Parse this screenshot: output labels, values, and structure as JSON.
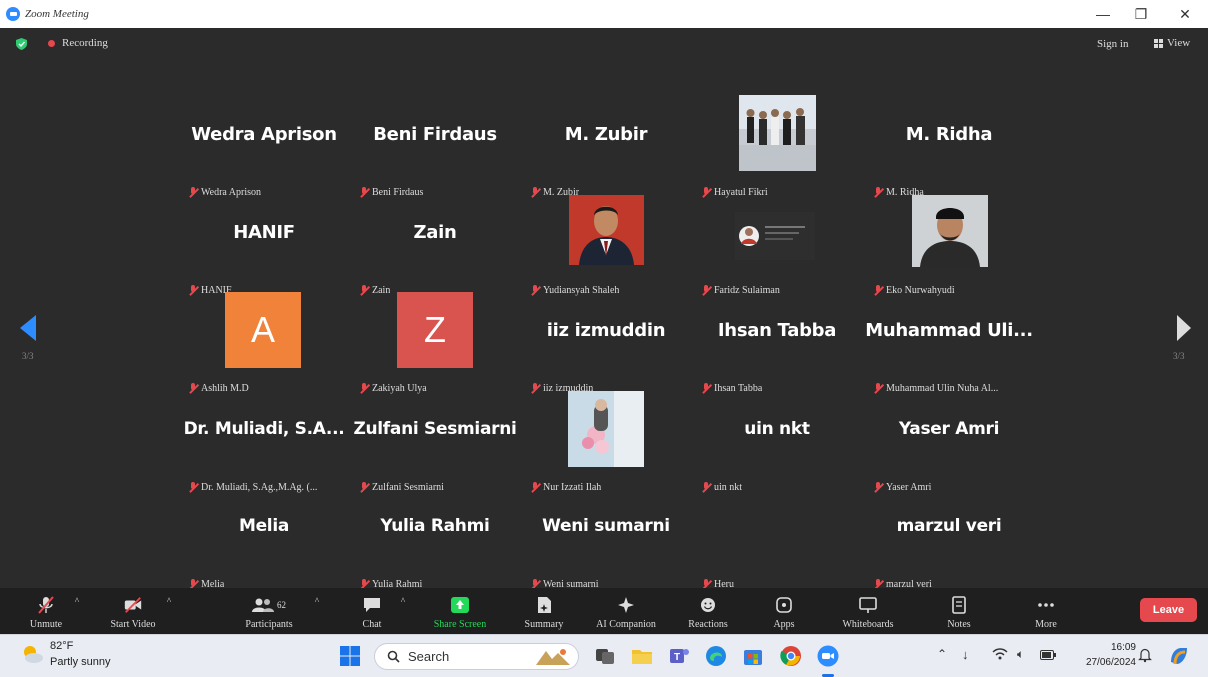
{
  "window": {
    "title": "Zoom Meeting"
  },
  "topbar": {
    "recording_label": "Recording",
    "signin_label": "Sign in",
    "view_label": "View"
  },
  "pagination": {
    "left": "3/3",
    "right": "3/3"
  },
  "tiles": [
    {
      "display_name": "Wedra Aprison",
      "label": "Wedra Aprison"
    },
    {
      "display_name": "Beni Firdaus",
      "label": "Beni Firdaus"
    },
    {
      "display_name": "M. Zubir",
      "label": "M. Zubir"
    },
    {
      "display_name": "",
      "label": "Hayatul Fikri"
    },
    {
      "display_name": "M. Ridha",
      "label": "M. Ridha"
    },
    {
      "display_name": "HANIF",
      "label": "HANIF"
    },
    {
      "display_name": "Zain",
      "label": "Zain"
    },
    {
      "display_name": "",
      "label": "Yudiansyah Shaleh"
    },
    {
      "display_name": "",
      "label": "Faridz Sulaiman"
    },
    {
      "display_name": "",
      "label": "Eko Nurwahyudi"
    },
    {
      "display_name": "",
      "label": "Ashlih M.D",
      "avatar_letter": "A",
      "avatar_color": "#F0823A"
    },
    {
      "display_name": "",
      "label": "Zakiyah Ulya",
      "avatar_letter": "Z",
      "avatar_color": "#D9534F"
    },
    {
      "display_name": "iiz izmuddin",
      "label": "iiz izmuddin"
    },
    {
      "display_name": "Ihsan Tabba",
      "label": "Ihsan Tabba"
    },
    {
      "display_name": "Muhammad Uli...",
      "label": "Muhammad Ulin Nuha Al..."
    },
    {
      "display_name": "Dr. Muliadi, S.A...",
      "label": "Dr. Muliadi, S.Ag.,M.Ag. (..."
    },
    {
      "display_name": "Zulfani Sesmiarni",
      "label": "Zulfani Sesmiarni"
    },
    {
      "display_name": "",
      "label": "Nur Izzati Ilah"
    },
    {
      "display_name": "uin nkt",
      "label": "uin nkt"
    },
    {
      "display_name": "Yaser Amri",
      "label": "Yaser Amri"
    },
    {
      "display_name": "Melia",
      "label": "Melia"
    },
    {
      "display_name": "Yulia Rahmi",
      "label": "Yulia Rahmi"
    },
    {
      "display_name": "Weni sumarni",
      "label": "Weni sumarni"
    },
    {
      "display_name": "",
      "label": "Heru"
    },
    {
      "display_name": "marzul veri",
      "label": "marzul veri"
    }
  ],
  "toolbar": {
    "unmute": "Unmute",
    "start_video": "Start Video",
    "participants": "Participants",
    "participants_count": "62",
    "chat": "Chat",
    "share_screen": "Share Screen",
    "summary": "Summary",
    "ai_companion": "AI Companion",
    "reactions": "Reactions",
    "apps": "Apps",
    "whiteboards": "Whiteboards",
    "notes": "Notes",
    "more": "More",
    "leave": "Leave"
  },
  "taskbar": {
    "weather_temp": "82°F",
    "weather_desc": "Partly sunny",
    "search_placeholder": "Search",
    "time": "16:09",
    "date": "27/06/2024"
  },
  "colors": {
    "accent": "#2D8CFF",
    "leave": "#E5484D",
    "stage_bg": "#2B2B2B",
    "share_green": "#23D959"
  }
}
